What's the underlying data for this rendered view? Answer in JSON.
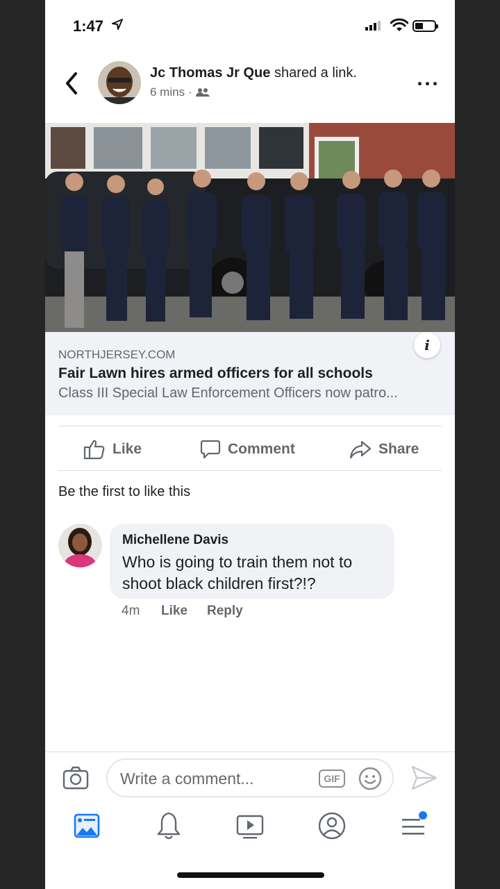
{
  "status_bar": {
    "time": "1:47"
  },
  "post": {
    "author": "Jc Thomas Jr Que",
    "action": "shared a link.",
    "time_ago": "6 mins",
    "audience_icon": "friends-icon"
  },
  "link_card": {
    "domain": "NORTHJERSEY.COM",
    "title": "Fair Lawn hires armed officers for all schools",
    "description": "Class III Special Law Enforcement Officers now patro..."
  },
  "actions": {
    "like": "Like",
    "comment": "Comment",
    "share": "Share"
  },
  "reactions_text": "Be the first to like this",
  "comments": [
    {
      "author": "Michellene Davis",
      "text": "Who is going to train them not to shoot black children first?!?",
      "time": "4m",
      "like": "Like",
      "reply": "Reply"
    }
  ],
  "composer": {
    "placeholder": "Write a comment...",
    "gif": "GIF"
  },
  "tab_bar": [
    "news-feed-icon",
    "notifications-icon",
    "watch-icon",
    "profile-icon",
    "menu-icon"
  ],
  "colors": {
    "facebook_blue": "#1877f2",
    "text": "#1c1e21",
    "secondary": "#65676b",
    "card_bg": "#f0f2f5"
  }
}
